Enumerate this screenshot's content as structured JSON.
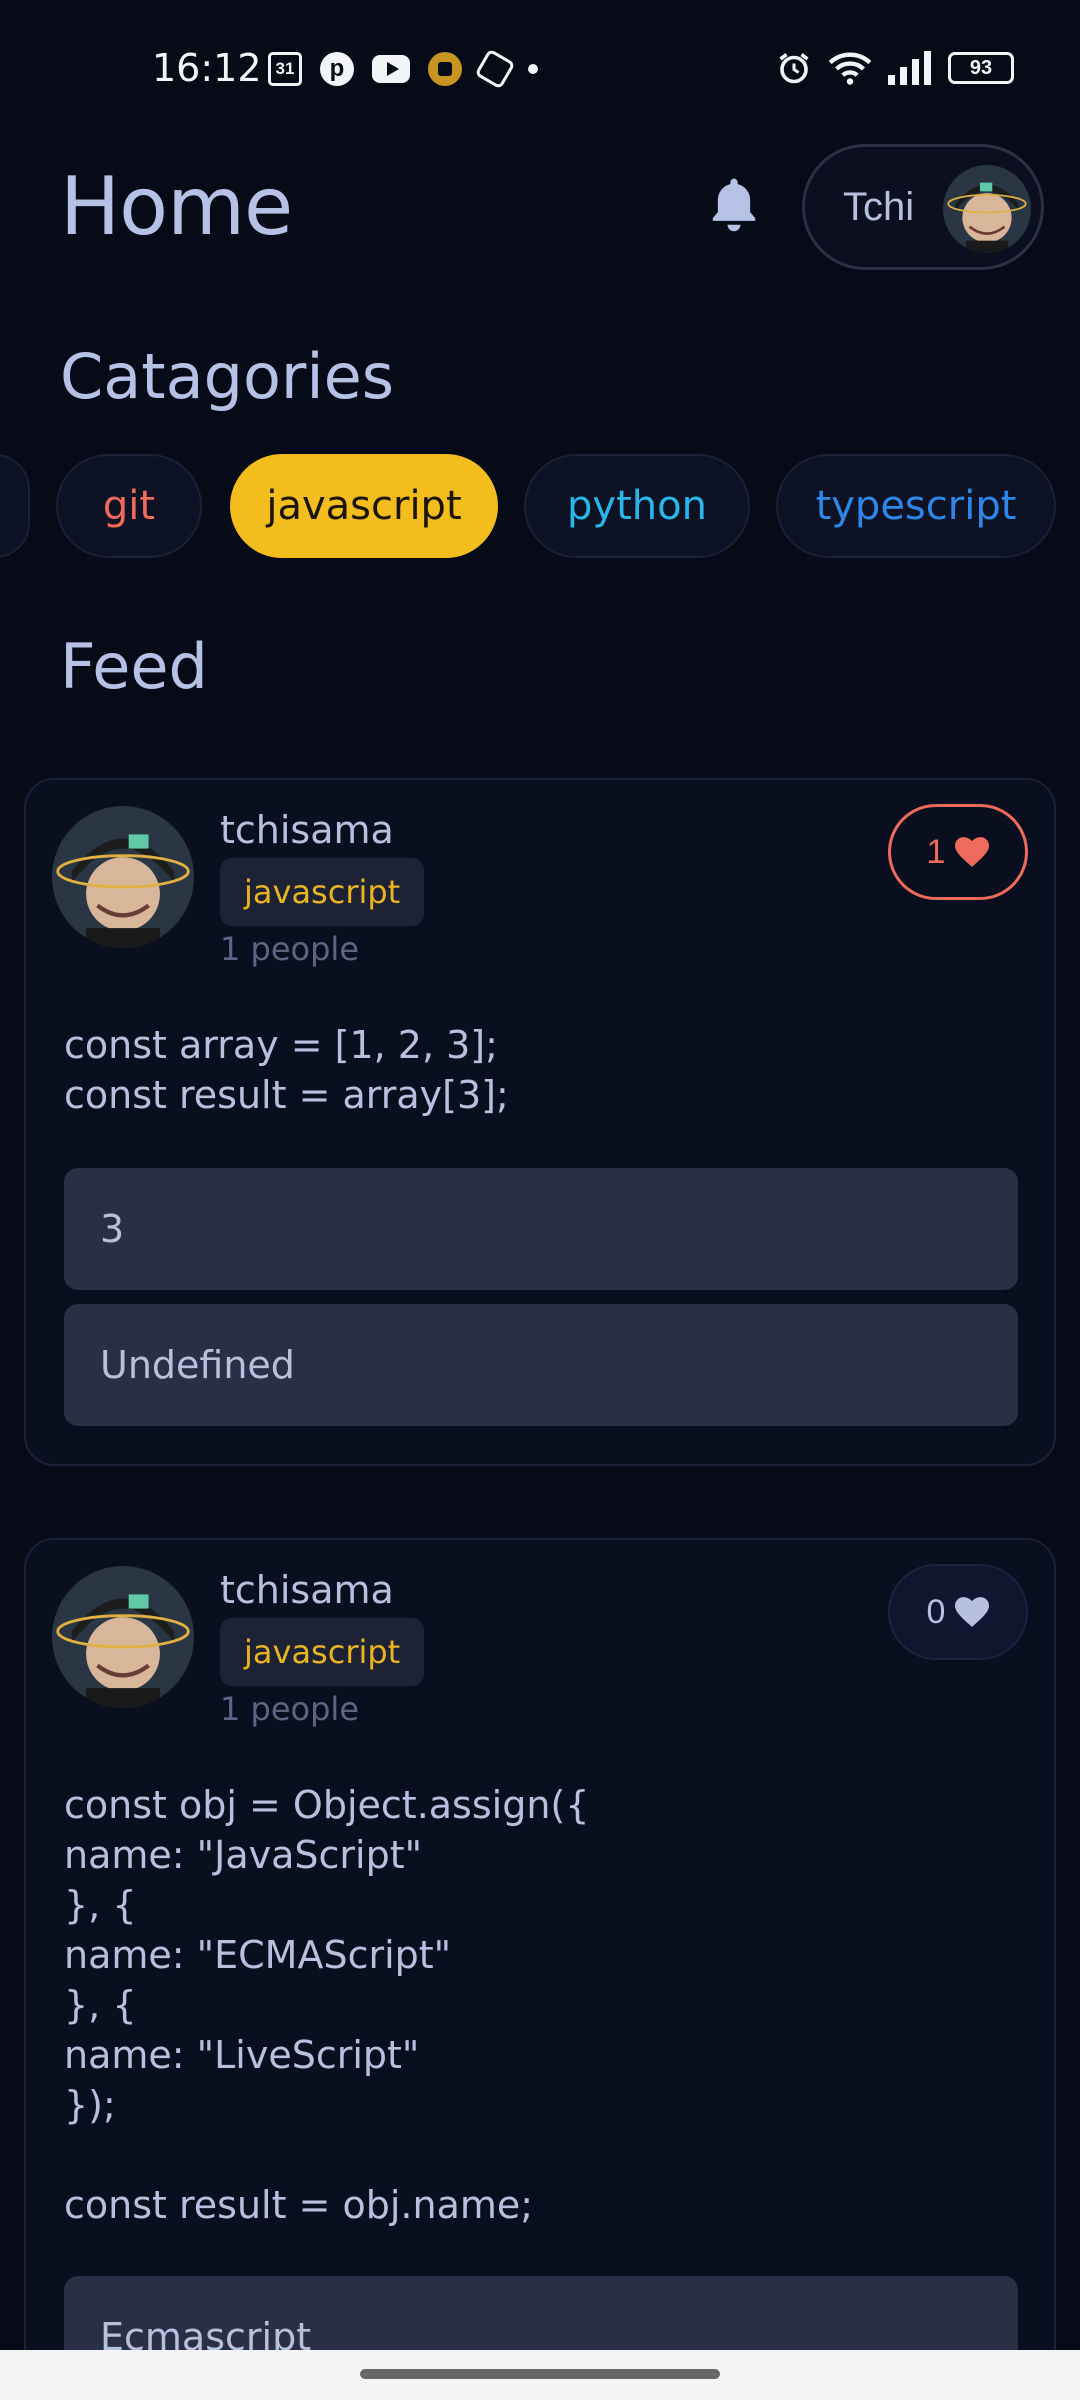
{
  "status_bar": {
    "time": "16:12",
    "calendar_day": "31",
    "battery": "93"
  },
  "header": {
    "title": "Home",
    "profile_name": "Tchi"
  },
  "categories": {
    "title": "Catagories",
    "items": [
      {
        "label": "git",
        "color": "#ef6a5c",
        "active": false
      },
      {
        "label": "javascript",
        "color": "#1a1505",
        "active": true
      },
      {
        "label": "python",
        "color": "#27b7e8",
        "active": false
      },
      {
        "label": "typescript",
        "color": "#2e86e8",
        "active": false
      }
    ]
  },
  "feed": {
    "title": "Feed",
    "posts": [
      {
        "author": "tchisama",
        "tag": "javascript",
        "people": "1 people",
        "likes": "1",
        "liked": true,
        "code": "const array = [1, 2, 3];\nconst result = array[3];",
        "answers": [
          "3",
          "Undefined"
        ]
      },
      {
        "author": "tchisama",
        "tag": "javascript",
        "people": "1 people",
        "likes": "0",
        "liked": false,
        "code": "const obj = Object.assign({\nname: \"JavaScript\"\n}, {\nname: \"ECMAScript\"\n}, {\nname: \"LiveScript\"\n});\n\nconst result = obj.name;",
        "answers": [
          "Ecmascript"
        ]
      }
    ]
  },
  "colors": {
    "background": "#070a17",
    "accent": "#f2bd1d",
    "like": "#ee6a5a"
  }
}
